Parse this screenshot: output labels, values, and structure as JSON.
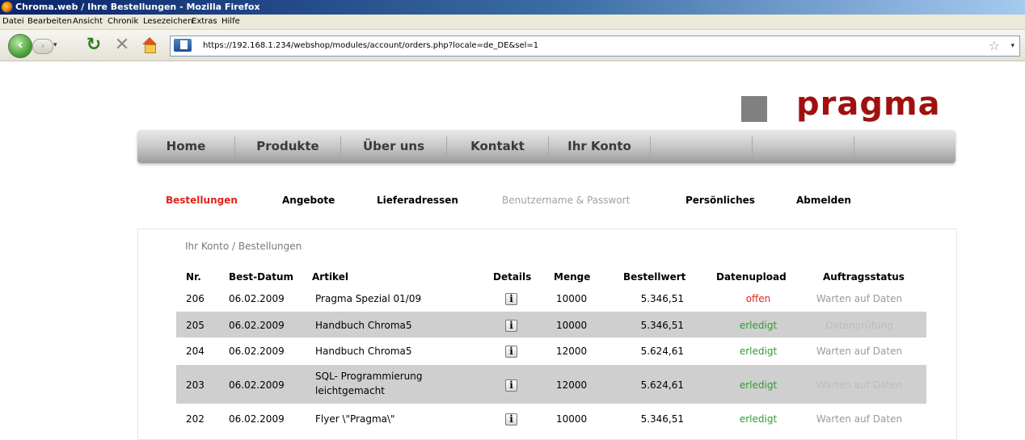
{
  "window": {
    "title": "Chroma.web / Ihre Bestellungen - Mozilla Firefox"
  },
  "menubar": [
    "Datei",
    "Bearbeiten",
    "Ansicht",
    "Chronik",
    "Lesezeichen",
    "Extras",
    "Hilfe"
  ],
  "toolbar": {
    "url": "https://192.168.1.234/webshop/modules/account/orders.php?locale=de_DE&sel=1"
  },
  "brand": {
    "logo_text": "pragma",
    "logo_color": "#a01010"
  },
  "main_nav": [
    "Home",
    "Produkte",
    "Über uns",
    "Kontakt",
    "Ihr Konto"
  ],
  "sub_nav": [
    {
      "label": "Bestellungen",
      "state": "active"
    },
    {
      "label": "Angebote",
      "state": "normal"
    },
    {
      "label": "Lieferadressen",
      "state": "normal"
    },
    {
      "label": "Benutzername & Passwort",
      "state": "disabled"
    },
    {
      "label": "Persönliches",
      "state": "normal"
    },
    {
      "label": "Abmelden",
      "state": "normal"
    }
  ],
  "breadcrumb": "Ihr Konto / Bestellungen",
  "table": {
    "headers": {
      "nr": "Nr.",
      "date": "Best-Datum",
      "article": "Artikel",
      "details": "Details",
      "qty": "Menge",
      "value": "Bestellwert",
      "upload": "Datenupload",
      "status": "Auftragsstatus"
    },
    "rows": [
      {
        "nr": "206",
        "date": "06.02.2009",
        "article": "Pragma Spezial 01/09",
        "article2": "",
        "qty": "10000",
        "value": "5.346,51",
        "upload": "offen",
        "status": "Warten auf Daten"
      },
      {
        "nr": "205",
        "date": "06.02.2009",
        "article": "Handbuch Chroma5",
        "article2": "",
        "qty": "10000",
        "value": "5.346,51",
        "upload": "erledigt",
        "status": "Datenprüfung"
      },
      {
        "nr": "204",
        "date": "06.02.2009",
        "article": "Handbuch Chroma5",
        "article2": "",
        "qty": "12000",
        "value": "5.624,61",
        "upload": "erledigt",
        "status": "Warten auf Daten"
      },
      {
        "nr": "203",
        "date": "06.02.2009",
        "article": "SQL- Programmierung",
        "article2": "leichtgemacht",
        "qty": "12000",
        "value": "5.624,61",
        "upload": "erledigt",
        "status": "Warten auf Daten"
      },
      {
        "nr": "202",
        "date": "06.02.2009",
        "article": "Flyer \\\"Pragma\\\"",
        "article2": "",
        "qty": "10000",
        "value": "5.346,51",
        "upload": "erledigt",
        "status": "Warten auf Daten"
      }
    ],
    "details_icon_glyph": "i"
  },
  "colors": {
    "active_red": "#e2231a",
    "done_green": "#2e9c2e",
    "stripe_gray": "#cfcfcf"
  }
}
